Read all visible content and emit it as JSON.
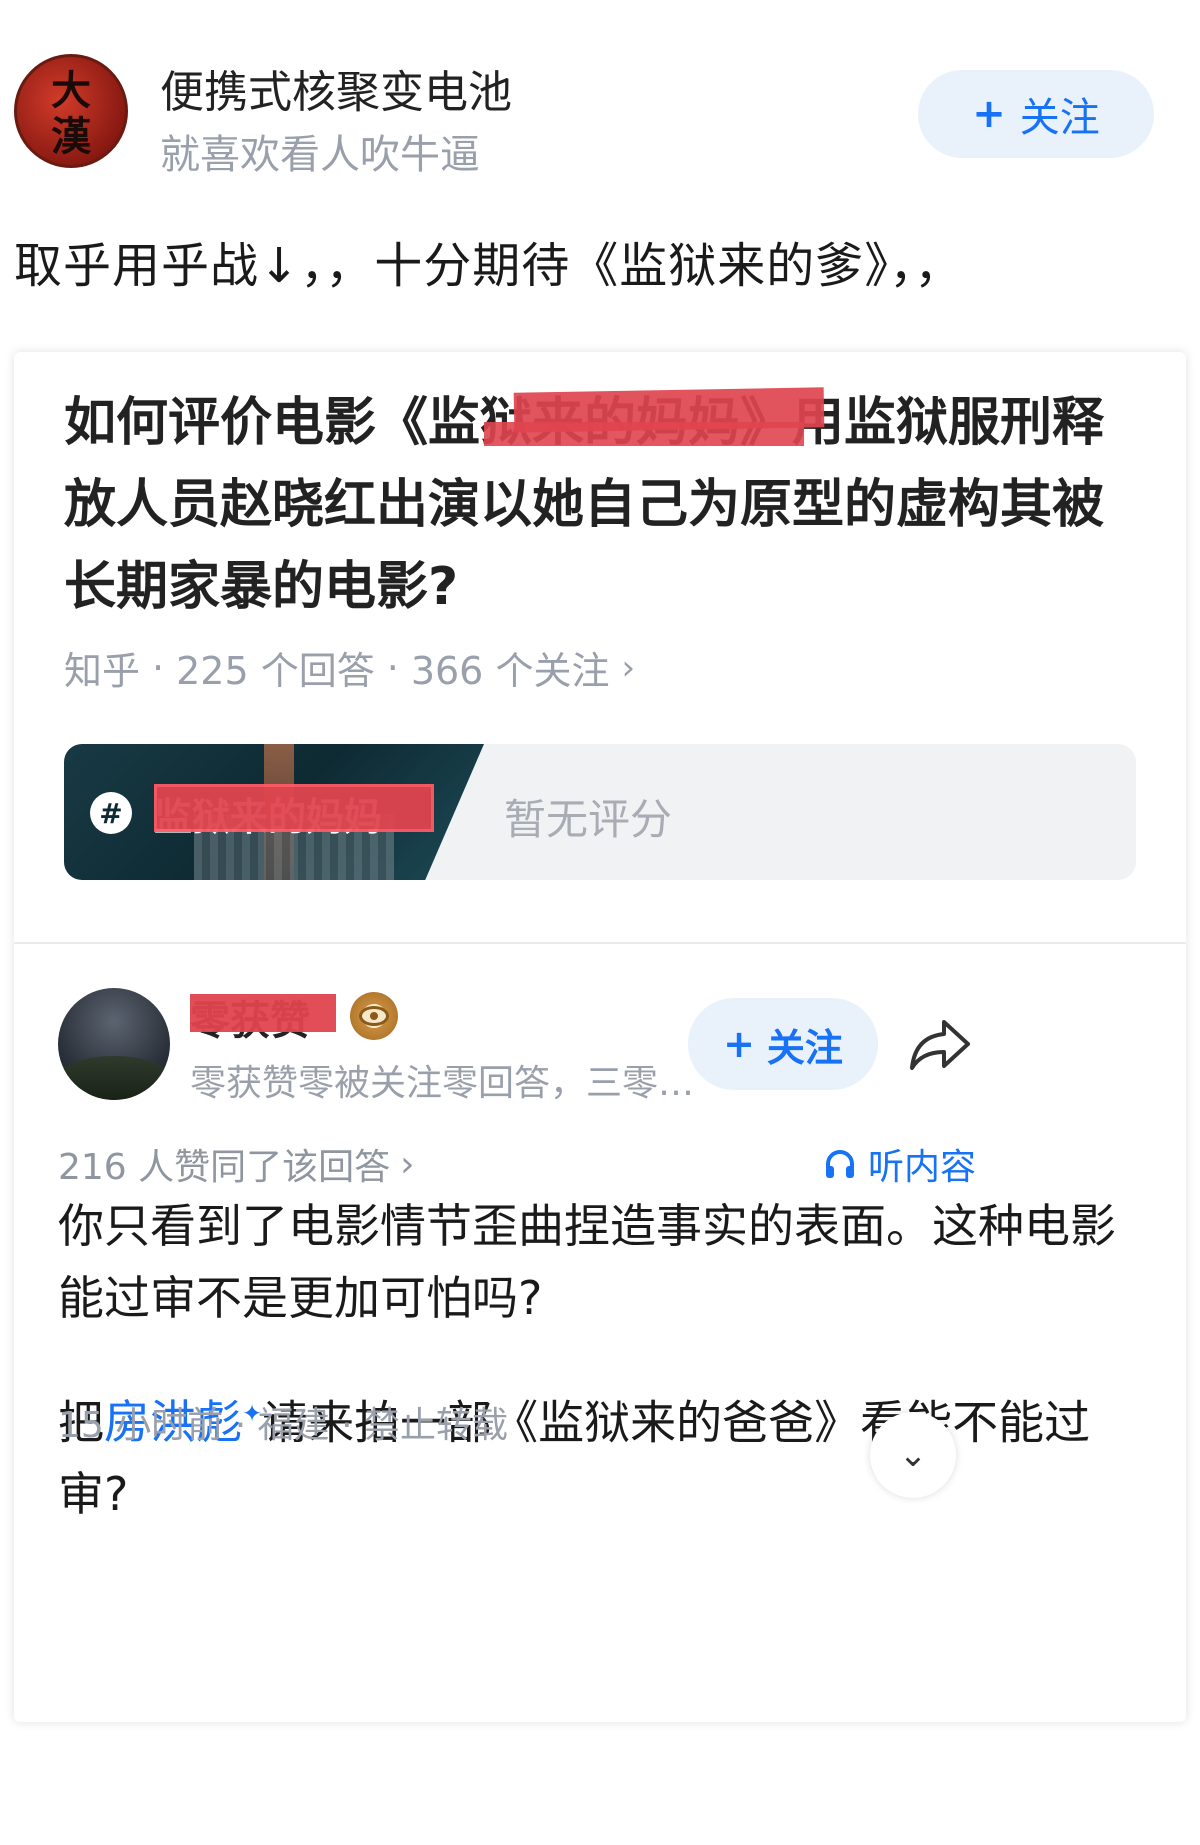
{
  "poster": {
    "avatar_text_top": "大",
    "avatar_text_bottom": "漢",
    "name": "便携式核聚变电池",
    "signature": "就喜欢看人吹牛逼",
    "follow_label": "关注",
    "follow_icon": "plus-icon"
  },
  "post": {
    "text": "取乎用乎战↓，，十分期待《监狱来的爹》，，"
  },
  "card": {
    "question_title": "如何评价电影《监狱来的妈妈》用监狱服刑释放人员赵晓红出演以她自己为原型的虚构其被长期家暴的电影?",
    "meta": {
      "source": "知乎",
      "answers": "225 个回答",
      "followers": "366 个关注",
      "sep": "·"
    },
    "topic": {
      "icon": "hashtag-icon",
      "name": "监狱来的妈妈",
      "rating": "暂无评分"
    },
    "answer": {
      "author_name": "零获赞",
      "author_desc": "零获赞零被关注零回答，三零…",
      "follow_label": "关注",
      "votes": "216 人赞同了该回答",
      "listen_label": "听内容",
      "body_p1": "你只看到了电影情节歪曲捏造事实的表面。这种电影能过审不是更加可怕吗?",
      "body_p2_before": "把",
      "body_p2_link": "房洪彪",
      "body_p2_after": "请来拍一部《监狱来的爸爸》看能不能过审?",
      "time": "15 小时前",
      "location": "福建",
      "repost": "禁止转载"
    },
    "colors": {
      "accent": "#1772f6",
      "redaction": "#e0454f",
      "muted": "#9aa0ab"
    }
  }
}
